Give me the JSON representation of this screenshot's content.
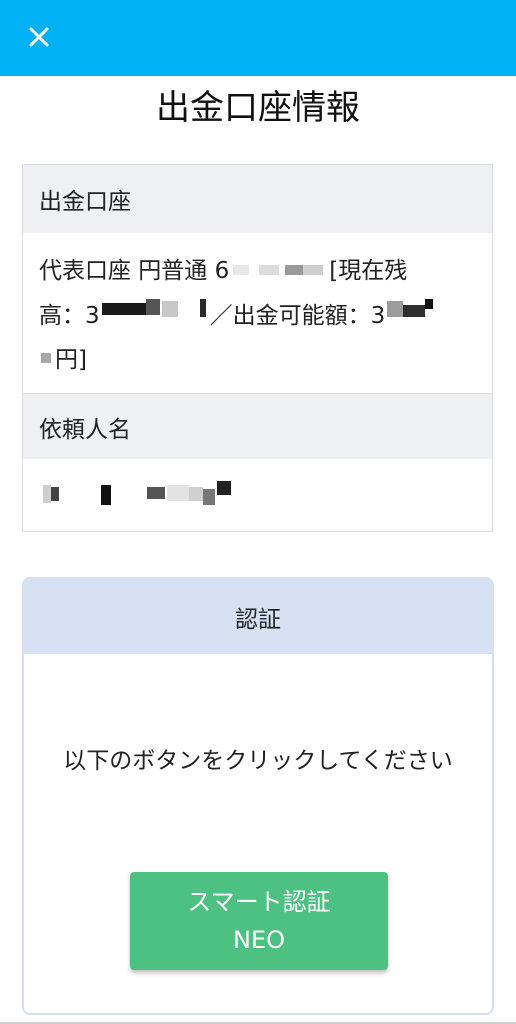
{
  "header": {
    "close_icon": "close-icon",
    "color": "#00b2f5"
  },
  "page_title": "出金口座情報",
  "withdrawal_account": {
    "heading": "出金口座",
    "text_line1": "代表口座 円普通 6",
    "text_balance_label": "[現在残",
    "text_line2a": "高：3",
    "text_line2b": "／出金可能額：3",
    "text_line3": "円]"
  },
  "requester": {
    "heading": "依頼人名"
  },
  "auth": {
    "heading": "認証",
    "instruction": "以下のボタンをクリックしてください",
    "button_line1": "スマート認証",
    "button_line2": "NEO",
    "button_color": "#4dc181"
  }
}
